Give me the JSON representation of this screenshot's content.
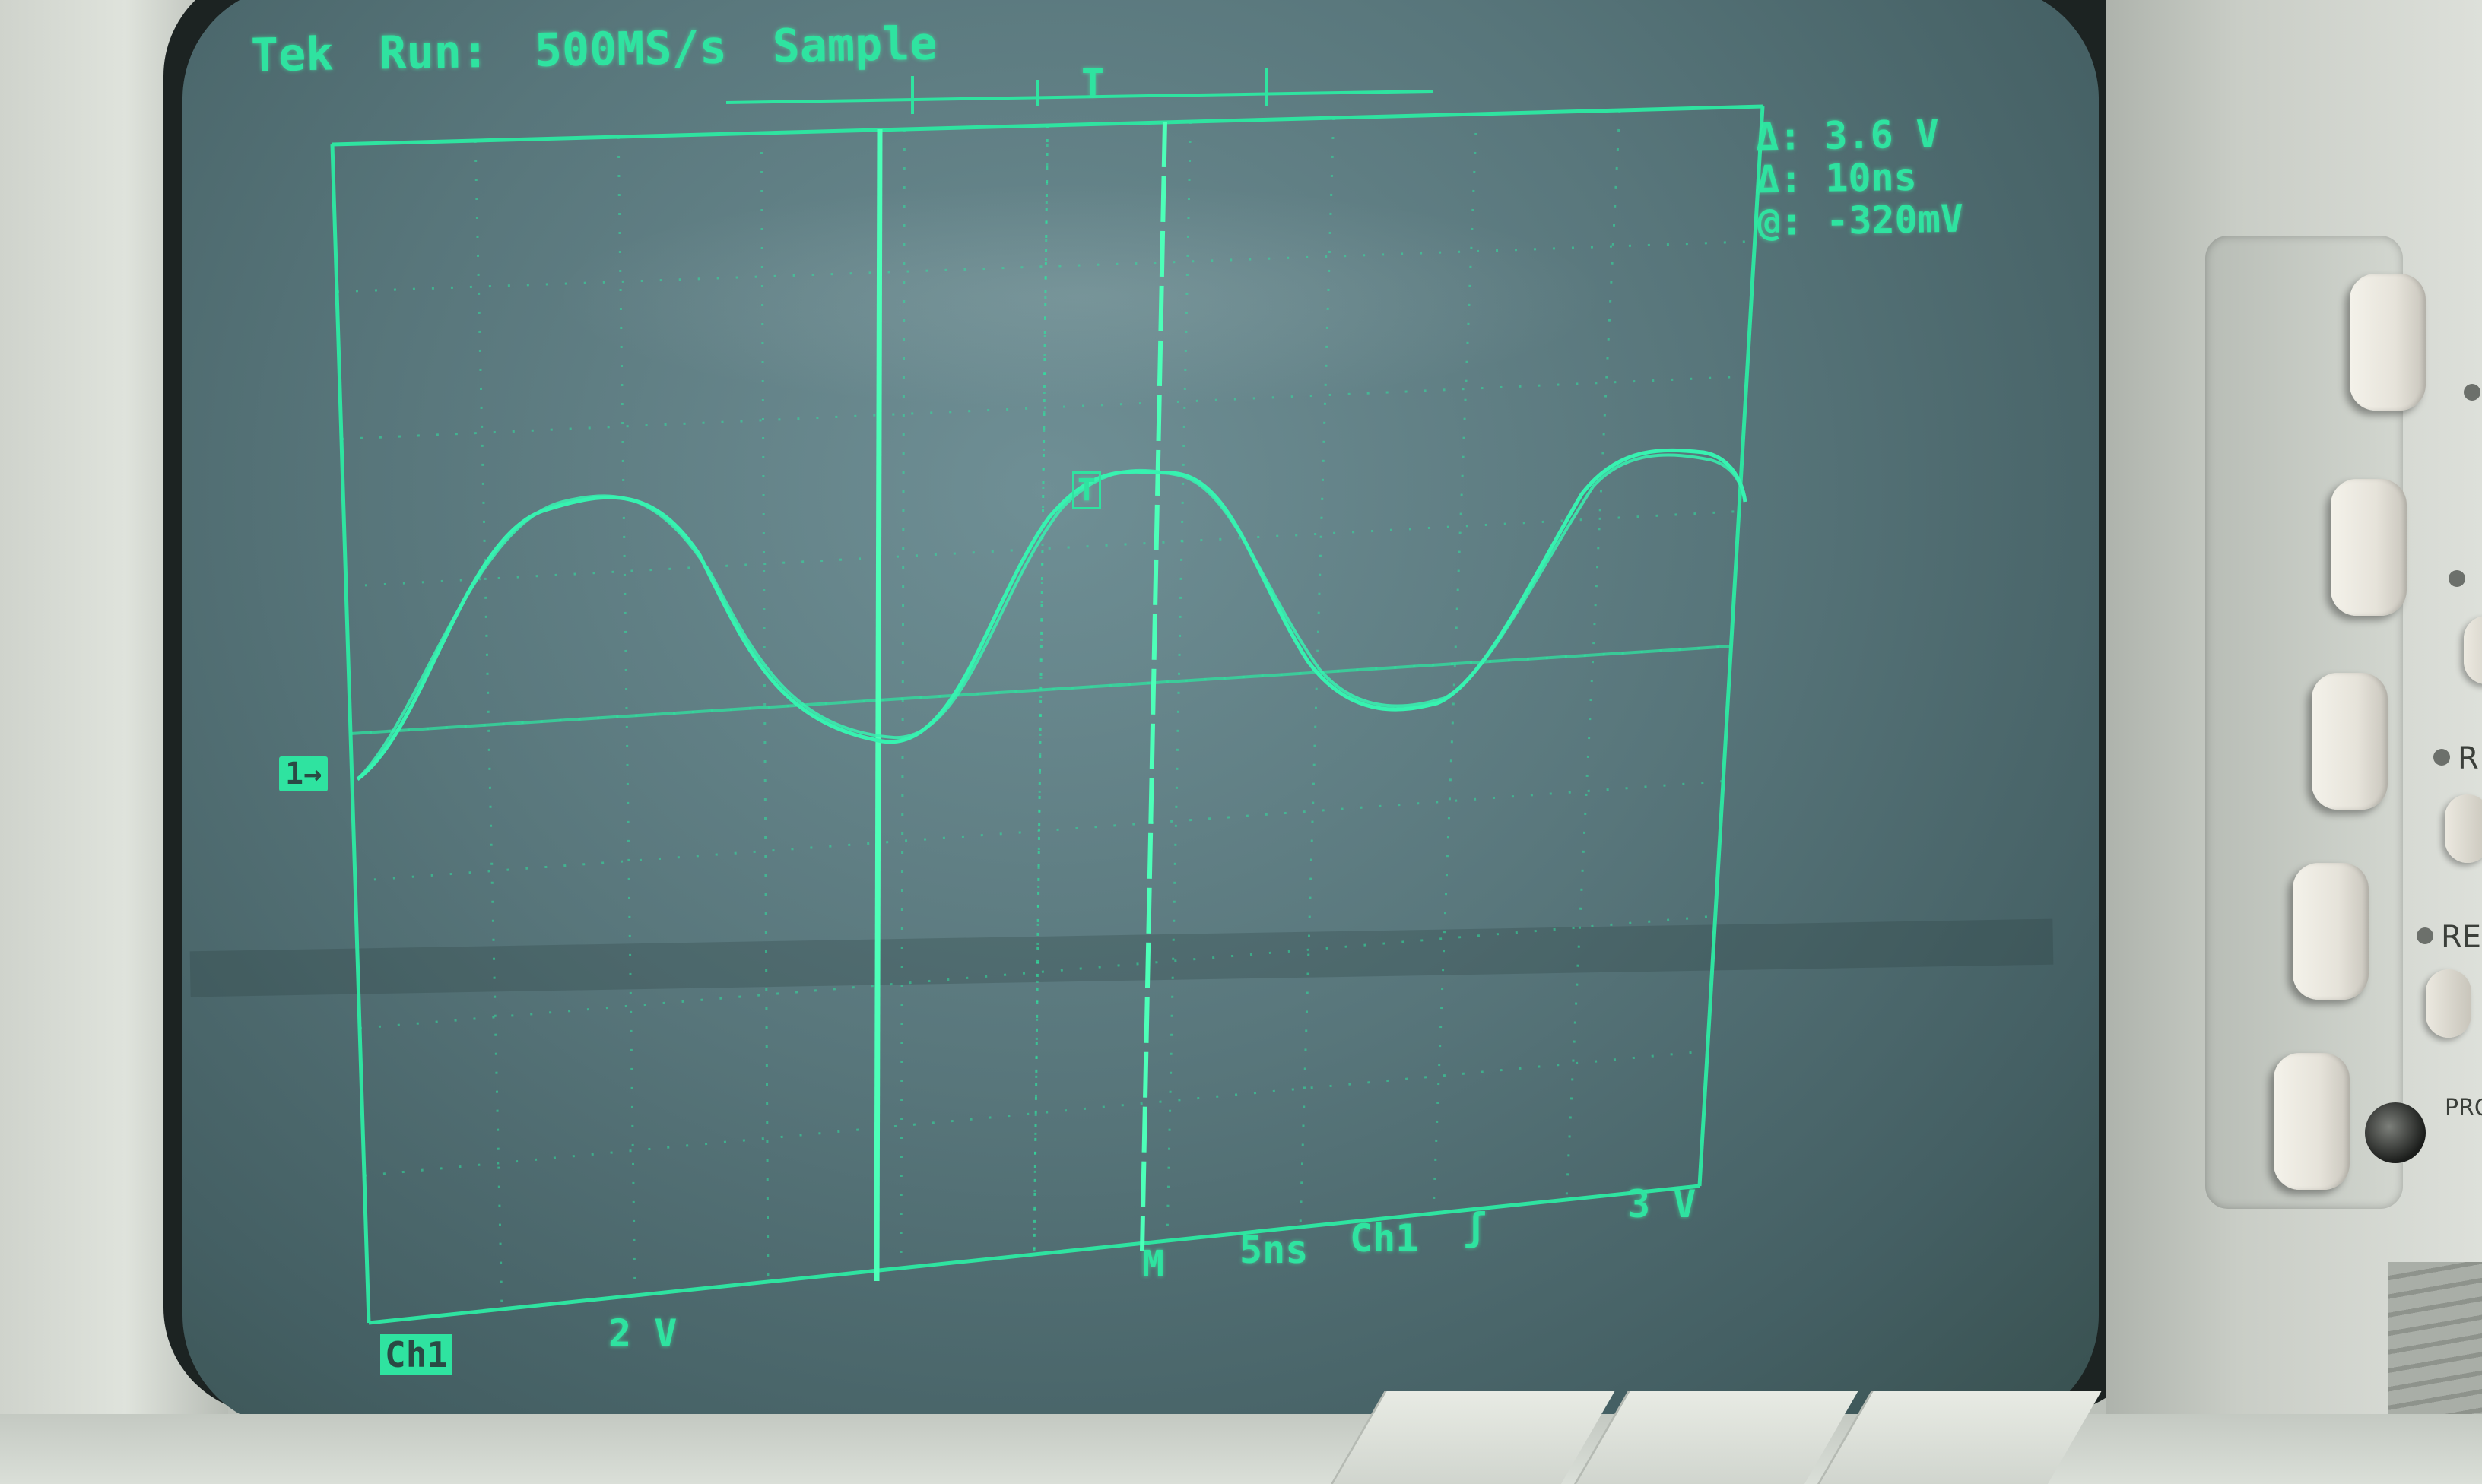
{
  "scope": {
    "status": {
      "brand": "Tek",
      "run_state": "Run:",
      "sample_rate": "500MS/s",
      "acquire_mode": "Sample"
    },
    "cursors": {
      "delta_voltage": "Δ: 3.6 V",
      "delta_time": "Δ: 10ns",
      "at_voltage": "@: -320mV"
    },
    "bottom": {
      "channel_label": "Ch1",
      "volts_per_div": "2 V",
      "marker": "M",
      "time_per_div": "5ns",
      "trigger_source": "Ch1",
      "trigger_slope": "ʃ",
      "trigger_level": "3 V"
    },
    "markers": {
      "ch1_ground": "1→",
      "trigger_top": "T",
      "trigger_level": "T"
    },
    "trace_color": "#2fe3a0",
    "screen_color": "#58767b"
  },
  "panel": {
    "labels": [
      "R",
      "RE",
      "PRO"
    ]
  }
}
